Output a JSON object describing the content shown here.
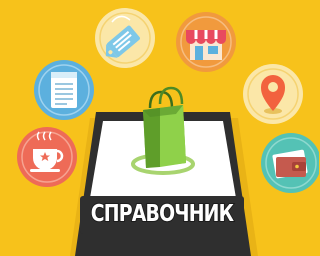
{
  "banner": {
    "label": "СПРАВОЧНИК"
  },
  "colors": {
    "background": "#f7c21b",
    "tablet_frame": "#2f2f2f",
    "screen": "#ffffff",
    "bag": "#7cbf3a",
    "circle_coral": "#ee6b57",
    "circle_blue": "#5cb0de",
    "circle_orange": "#f19a3d",
    "circle_teal": "#54c2b5",
    "circle_cream": "#fbe7a8"
  },
  "icons": [
    "coffee-cup-icon",
    "document-icon",
    "price-tag-icon",
    "storefront-icon",
    "map-pin-icon",
    "wallet-icon",
    "shopping-bag-icon"
  ]
}
